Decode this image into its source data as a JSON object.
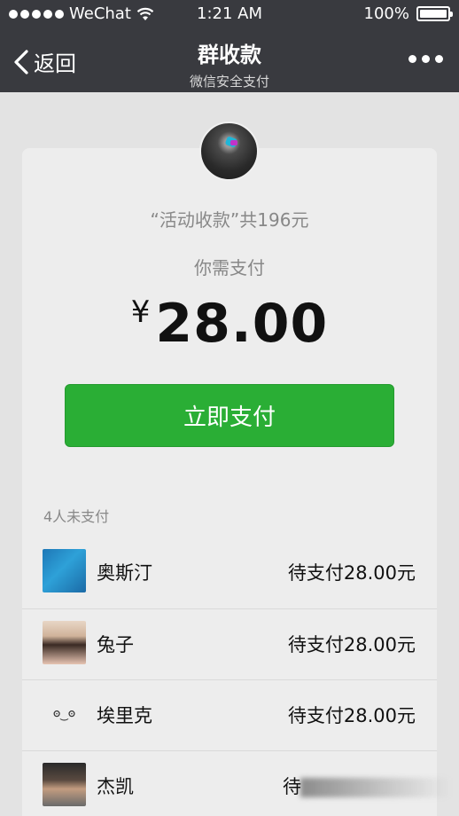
{
  "status_bar": {
    "carrier": "WeChat",
    "time": "1:21 AM",
    "battery": "100%"
  },
  "nav": {
    "back_label": "返回",
    "title": "群收款",
    "subtitle": "微信安全支付"
  },
  "collection": {
    "quote_open": "“",
    "name": "活动收款",
    "quote_close": "”",
    "total_text": "共196元",
    "need_pay_label": "你需支付",
    "currency": "¥",
    "amount": "28.00",
    "pay_button_label": "立即支付"
  },
  "unpaid": {
    "header": "4人未支付",
    "members": [
      {
        "name": "奥斯汀",
        "status": "待支付28.00元"
      },
      {
        "name": "兔子",
        "status": "待支付28.00元"
      },
      {
        "name": "埃里克",
        "status": "待支付28.00元",
        "avatar_text": "ʘ‿ʘ"
      },
      {
        "name": "杰凯",
        "status": "待"
      }
    ]
  },
  "colors": {
    "nav_bg": "#393a3f",
    "pay_green": "#2aae35",
    "page_bg": "#e3e3e3"
  }
}
